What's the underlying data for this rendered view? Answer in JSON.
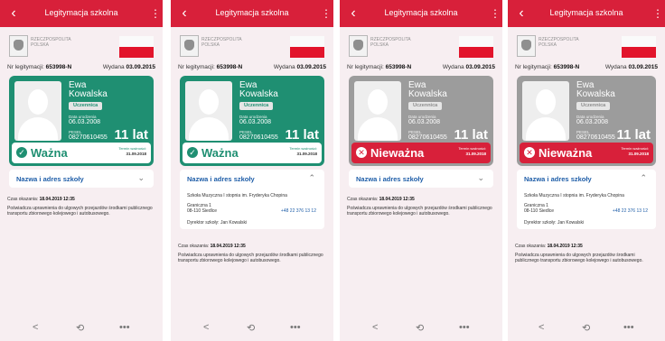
{
  "screens": [
    {
      "appbar": {
        "title": "Legitymacja szkolna"
      },
      "country": {
        "line1": "RZECZPOSPOLITA",
        "line2": "POLSKA"
      },
      "meta": {
        "num_label": "Nr legitymacji:",
        "num_value": "653998-N",
        "issued_label": "Wydana",
        "issued_value": "03.09.2015"
      },
      "card": {
        "first_name": "Ewa",
        "last_name": "Kowalska",
        "role": "Uczennica",
        "birth_label": "Data urodzenia",
        "birth_value": "06.03.2008",
        "pesel_label": "PESEL",
        "pesel_value": "08270610455",
        "age": "11 lat",
        "status_text": "Ważna",
        "status_icon": "✓",
        "term_label": "Termin ważności:",
        "term_value": "31.09.2018"
      },
      "school": {
        "title": "Nazwa i adres szkoły",
        "chevron": "⌄"
      },
      "dates": {
        "check_label": "Czas okazania:",
        "check_value": "18.04.2019 12:35",
        "note": "Poświadcza uprawnienia do ulgowych przejazdów środkami publicznego transportu zbiorowego kolejowego i autobusowego."
      }
    },
    {
      "appbar": {
        "title": "Legitymacja szkolna"
      },
      "country": {
        "line1": "RZECZPOSPOLITA",
        "line2": "POLSKA"
      },
      "meta": {
        "num_label": "Nr legitymacji:",
        "num_value": "653998-N",
        "issued_label": "Wydana",
        "issued_value": "03.09.2015"
      },
      "card": {
        "first_name": "Ewa",
        "last_name": "Kowalska",
        "role": "Uczennica",
        "birth_label": "Data urodzenia",
        "birth_value": "06.03.2008",
        "pesel_label": "PESEL",
        "pesel_value": "08270610455",
        "age": "11 lat",
        "status_text": "Ważna",
        "status_icon": "✓",
        "term_label": "Termin ważności:",
        "term_value": "31.09.2018"
      },
      "school": {
        "title": "Nazwa i adres szkoły",
        "chevron": "⌃",
        "name": "Szkoła Muzyczna I stopnia im. Fryderyka Chopina",
        "street": "Graniczna 1",
        "city": "08-110 Siedlce",
        "phone": "+48 22 376 13 12",
        "director": "Dyrektor szkoły: Jan Kowalski"
      },
      "dates": {
        "check_label": "Czas okazania:",
        "check_value": "18.04.2019 12:35",
        "note": "Poświadcza uprawnienia do ulgowych przejazdów środkami publicznego transportu zbiorowego kolejowego i autobusowego."
      }
    },
    {
      "appbar": {
        "title": "Legitymacja szkolna"
      },
      "country": {
        "line1": "RZECZPOSPOLITA",
        "line2": "POLSKA"
      },
      "meta": {
        "num_label": "Nr legitymacji:",
        "num_value": "653998-N",
        "issued_label": "Wydana",
        "issued_value": "03.09.2015"
      },
      "card": {
        "first_name": "Ewa",
        "last_name": "Kowalska",
        "role": "Uczennica",
        "birth_label": "Data urodzenia",
        "birth_value": "06.03.2008",
        "pesel_label": "PESEL",
        "pesel_value": "08270610455",
        "age": "11 lat",
        "status_text": "Nieważna",
        "status_icon": "✕",
        "term_label": "Termin ważności:",
        "term_value": "31.09.2018"
      },
      "school": {
        "title": "Nazwa i adres szkoły",
        "chevron": "⌄"
      },
      "dates": {
        "check_label": "Czas okazania:",
        "check_value": "18.04.2019 12:35",
        "note": "Poświadcza uprawnienia do ulgowych przejazdów środkami publicznego transportu zbiorowego kolejowego i autobusowego."
      }
    },
    {
      "appbar": {
        "title": "Legitymacja szkolna"
      },
      "country": {
        "line1": "RZECZPOSPOLITA",
        "line2": "POLSKA"
      },
      "meta": {
        "num_label": "Nr legitymacji:",
        "num_value": "653998-N",
        "issued_label": "Wydana",
        "issued_value": "03.09.2015"
      },
      "card": {
        "first_name": "Ewa",
        "last_name": "Kowalska",
        "role": "Uczennica",
        "birth_label": "Data urodzenia",
        "birth_value": "06.03.2008",
        "pesel_label": "PESEL",
        "pesel_value": "08270610455",
        "age": "11 lat",
        "status_text": "Nieważna",
        "status_icon": "✕",
        "term_label": "Termin ważności:",
        "term_value": "31.09.2018"
      },
      "school": {
        "title": "Nazwa i adres szkoły",
        "chevron": "⌃",
        "name": "Szkoła Muzyczna I stopnia im. Fryderyka Chopina",
        "street": "Graniczna 1",
        "city": "08-110 Siedlce",
        "phone": "+48 22 376 13 12",
        "director": "Dyrektor szkoły: Jan Kowalski"
      },
      "dates": {
        "check_label": "Czas okazania:",
        "check_value": "18.04.2019 12:35",
        "note": "Poświadcza uprawnienia do ulgowych przejazdów środkami publicznego transportu zbiorowego kolejowego i autobusowego."
      }
    }
  ],
  "icons": {
    "back": "back-arrow-icon",
    "more": "more-vertical-icon",
    "share": "share-icon",
    "history": "history-icon",
    "menu": "more-horizontal-icon"
  },
  "colors": {
    "primary_red": "#d8203a",
    "valid_green": "#1f8f72",
    "invalid_gray": "#9c9c9c",
    "link_blue": "#1f5ea8"
  }
}
